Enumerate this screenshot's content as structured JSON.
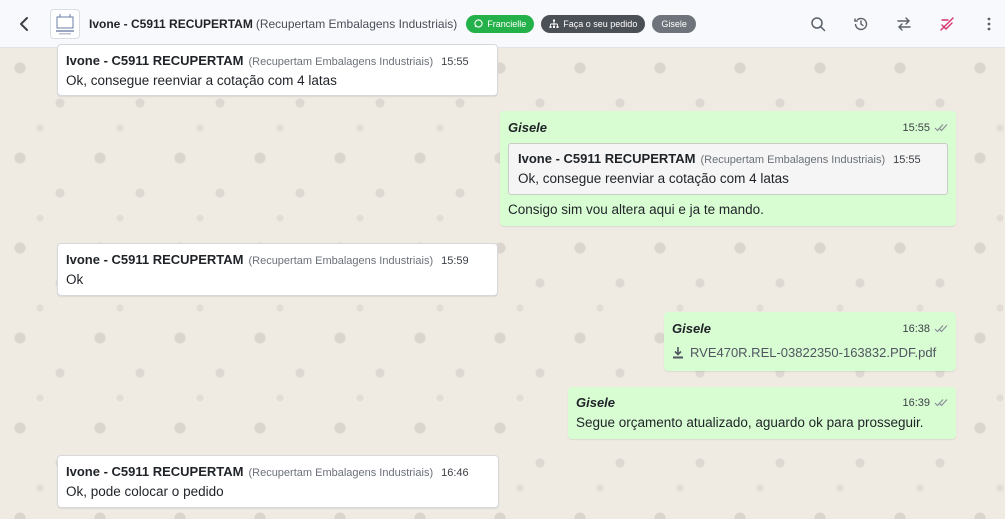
{
  "header": {
    "contact_name": "Ivone - C5911 RECUPERTAM",
    "contact_company": "(Recupertam Embalagens Industriais)",
    "tags": [
      "Francielle",
      "Faça o seu pedido",
      "Gisele"
    ],
    "icons": [
      "search-icon",
      "history-icon",
      "transfer-icon",
      "ban-icon",
      "more-icon"
    ],
    "colors": {
      "tag_green": "#25b14a",
      "tag_dark": "#4b4f56",
      "tag_grey": "#6f747c",
      "ban_icon": "#d6336c"
    }
  },
  "messages": [
    {
      "direction": "incoming",
      "sender": "Ivone - C5911 RECUPERTAM",
      "company": "(Recupertam Embalagens Industriais)",
      "time": "15:55",
      "text": "Ok, consegue reenviar a cotação com 4 latas"
    },
    {
      "direction": "outgoing",
      "sender": "Gisele",
      "time": "15:55",
      "quote": {
        "sender": "Ivone - C5911 RECUPERTAM",
        "company": "(Recupertam Embalagens Industriais)",
        "time": "15:55",
        "text": "Ok, consegue reenviar a cotação com 4 latas"
      },
      "text": "Consigo sim vou altera aqui e ja te mando."
    },
    {
      "direction": "incoming",
      "sender": "Ivone - C5911 RECUPERTAM",
      "company": "(Recupertam Embalagens Industriais)",
      "time": "15:59",
      "text": "Ok"
    },
    {
      "direction": "outgoing",
      "sender": "Gisele",
      "time": "16:38",
      "attachment": "RVE470R.REL-03822350-163832.PDF.pdf"
    },
    {
      "direction": "outgoing",
      "sender": "Gisele",
      "time": "16:39",
      "text": "Segue orçamento atualizado, aguardo ok para prosseguir."
    },
    {
      "direction": "incoming",
      "sender": "Ivone - C5911 RECUPERTAM",
      "company": "(Recupertam Embalagens Industriais)",
      "time": "16:46",
      "text": "Ok, pode colocar o pedido"
    }
  ]
}
